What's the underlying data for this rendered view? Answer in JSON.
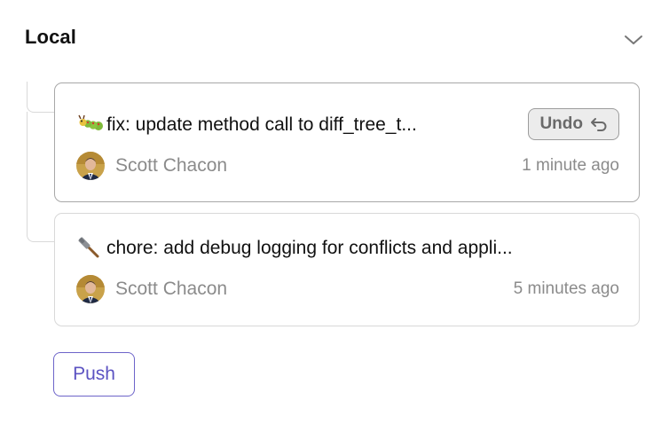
{
  "section": {
    "title": "Local",
    "collapse_icon": "chevron-down-icon"
  },
  "commits": [
    {
      "icon": "caterpillar-icon",
      "message": "fix: update method call to diff_tree_t...",
      "author": "Scott Chacon",
      "time": "1 minute ago",
      "undo_label": "Undo",
      "undo_icon": "undo-arrow-icon"
    },
    {
      "icon": "hammer-icon",
      "message": "chore: add debug logging for conflicts and appli...",
      "author": "Scott Chacon",
      "time": "5 minutes ago"
    }
  ],
  "actions": {
    "push_label": "Push"
  },
  "colors": {
    "accent": "#5c53c2",
    "muted_text": "#8b8b8b",
    "card_border": "#d8d8d8",
    "card_border_selected": "#a8a8a8",
    "undo_bg": "#ececec"
  }
}
